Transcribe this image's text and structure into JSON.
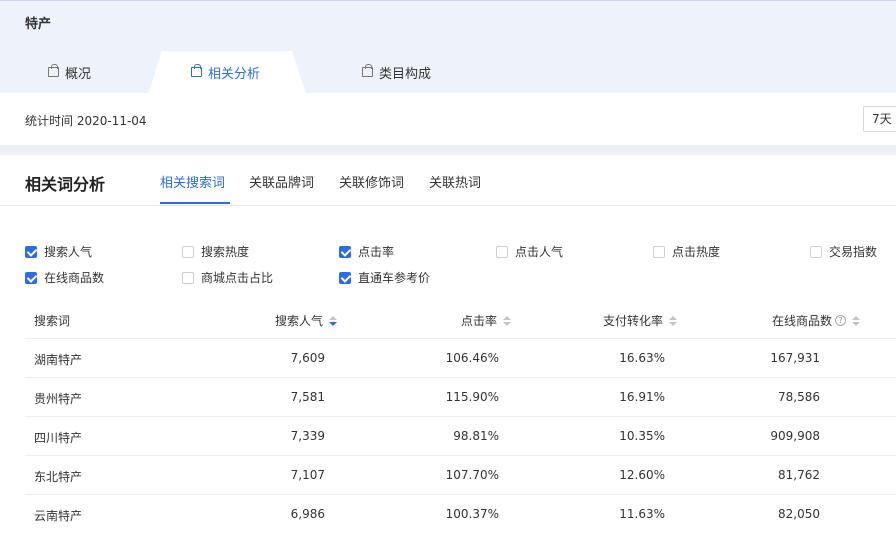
{
  "header": {
    "page_title": "特产",
    "tabs": [
      {
        "label": "概况"
      },
      {
        "label": "相关分析"
      },
      {
        "label": "类目构成"
      }
    ]
  },
  "datebar": {
    "stat_time": "统计时间 2020-11-04",
    "range": "7天"
  },
  "panel": {
    "title": "相关词分析",
    "subtabs": [
      {
        "label": "相关搜索词"
      },
      {
        "label": "关联品牌词"
      },
      {
        "label": "关联修饰词"
      },
      {
        "label": "关联热词"
      }
    ],
    "metrics": [
      {
        "label": "搜索人气",
        "checked": true
      },
      {
        "label": "搜索热度",
        "checked": false
      },
      {
        "label": "点击率",
        "checked": true
      },
      {
        "label": "点击人气",
        "checked": false
      },
      {
        "label": "点击热度",
        "checked": false
      },
      {
        "label": "交易指数",
        "checked": false
      },
      {
        "label": "在线商品数",
        "checked": true
      },
      {
        "label": "商城点击占比",
        "checked": false
      },
      {
        "label": "直通车参考价",
        "checked": true
      }
    ],
    "table": {
      "columns": [
        "搜索词",
        "搜索人气",
        "点击率",
        "支付转化率",
        "在线商品数"
      ],
      "help_icon": "?",
      "rows": [
        [
          "湖南特产",
          "7,609",
          "106.46%",
          "16.63%",
          "167,931"
        ],
        [
          "贵州特产",
          "7,581",
          "115.90%",
          "16.91%",
          "78,586"
        ],
        [
          "四川特产",
          "7,339",
          "98.81%",
          "10.35%",
          "909,908"
        ],
        [
          "东北特产",
          "7,107",
          "107.70%",
          "12.60%",
          "81,762"
        ],
        [
          "云南特产",
          "6,986",
          "100.37%",
          "11.63%",
          "82,050"
        ]
      ]
    }
  },
  "colors": {
    "accent": "#2e6be6",
    "header_bg": "#eef3fb"
  }
}
